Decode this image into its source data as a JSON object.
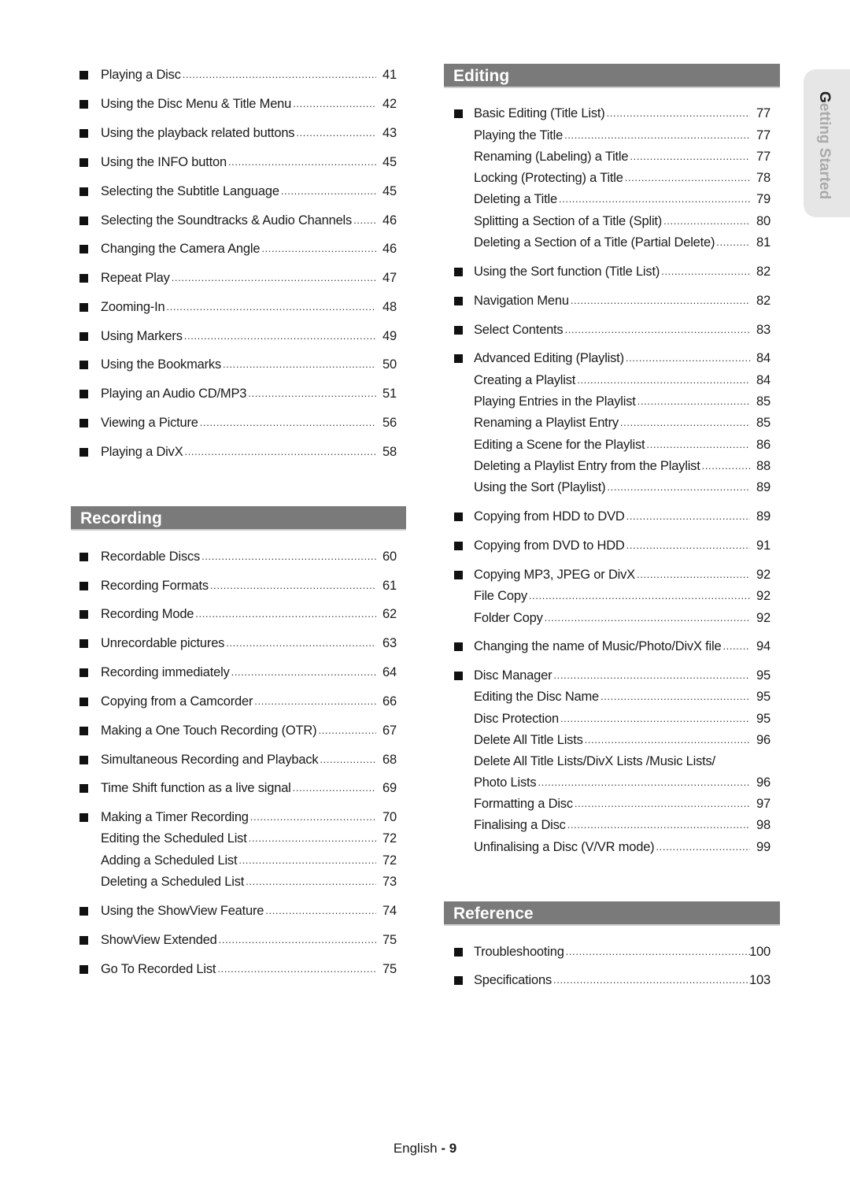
{
  "side_tab": {
    "first_letter": "G",
    "rest": "etting Started"
  },
  "footer": {
    "language": "English",
    "separator": "-",
    "page_number": "9"
  },
  "left": {
    "playback_items": [
      {
        "label": "Playing a Disc",
        "page": "41",
        "bullet": true
      },
      {
        "label": "Using the Disc Menu & Title Menu",
        "page": "42",
        "bullet": true
      },
      {
        "label": "Using the playback related buttons",
        "page": "43",
        "bullet": true
      },
      {
        "label": "Using the INFO button",
        "page": "45",
        "bullet": true
      },
      {
        "label": "Selecting the Subtitle Language",
        "page": "45",
        "bullet": true
      },
      {
        "label": "Selecting the Soundtracks & Audio Channels",
        "page": "46",
        "bullet": true
      },
      {
        "label": "Changing the Camera Angle",
        "page": "46",
        "bullet": true
      },
      {
        "label": "Repeat Play",
        "page": "47",
        "bullet": true
      },
      {
        "label": "Zooming-In",
        "page": "48",
        "bullet": true
      },
      {
        "label": "Using Markers",
        "page": "49",
        "bullet": true
      },
      {
        "label": "Using the Bookmarks",
        "page": "50",
        "bullet": true
      },
      {
        "label": "Playing an Audio CD/MP3",
        "page": "51",
        "bullet": true
      },
      {
        "label": "Viewing a Picture",
        "page": "56",
        "bullet": true
      },
      {
        "label": "Playing a DivX",
        "page": "58",
        "bullet": true
      }
    ],
    "recording": {
      "title": "Recording",
      "items": [
        {
          "label": "Recordable Discs",
          "page": "60",
          "bullet": true
        },
        {
          "label": "Recording Formats",
          "page": "61",
          "bullet": true
        },
        {
          "label": "Recording Mode",
          "page": "62",
          "bullet": true
        },
        {
          "label": "Unrecordable pictures",
          "page": "63",
          "bullet": true
        },
        {
          "label": "Recording immediately",
          "page": "64",
          "bullet": true
        },
        {
          "label": "Copying from a Camcorder",
          "page": "66",
          "bullet": true
        },
        {
          "label": "Making a One Touch Recording (OTR)",
          "page": "67",
          "bullet": true
        },
        {
          "label": "Simultaneous Recording and Playback",
          "page": "68",
          "bullet": true
        },
        {
          "label": "Time Shift function as a live signal",
          "page": "69",
          "bullet": true
        },
        {
          "label": "Making a Timer Recording",
          "page": "70",
          "bullet": true
        },
        {
          "label": "Editing the Scheduled List",
          "page": "72",
          "bullet": false
        },
        {
          "label": "Adding a Scheduled List",
          "page": "72",
          "bullet": false
        },
        {
          "label": "Deleting a Scheduled List",
          "page": "73",
          "bullet": false
        },
        {
          "label": "Using the ShowView Feature",
          "page": "74",
          "bullet": true
        },
        {
          "label": "ShowView Extended",
          "page": "75",
          "bullet": true
        },
        {
          "label": "Go To Recorded List",
          "page": "75",
          "bullet": true
        }
      ]
    }
  },
  "right": {
    "editing": {
      "title": "Editing",
      "items": [
        {
          "label": "Basic Editing (Title List)",
          "page": "77",
          "bullet": true
        },
        {
          "label": "Playing the Title",
          "page": "77",
          "bullet": false
        },
        {
          "label": "Renaming (Labeling) a Title",
          "page": "77",
          "bullet": false
        },
        {
          "label": "Locking (Protecting) a Title",
          "page": "78",
          "bullet": false
        },
        {
          "label": "Deleting a Title",
          "page": "79",
          "bullet": false
        },
        {
          "label": "Splitting a Section of a Title (Split)",
          "page": "80",
          "bullet": false
        },
        {
          "label": "Deleting a Section of a Title (Partial Delete)",
          "page": "81",
          "bullet": false
        },
        {
          "label": "Using the Sort function (Title List)",
          "page": "82",
          "bullet": true
        },
        {
          "label": "Navigation Menu",
          "page": "82",
          "bullet": true
        },
        {
          "label": "Select Contents",
          "page": "83",
          "bullet": true
        },
        {
          "label": "Advanced Editing (Playlist)",
          "page": "84",
          "bullet": true
        },
        {
          "label": "Creating a Playlist",
          "page": "84",
          "bullet": false
        },
        {
          "label": "Playing Entries in the Playlist",
          "page": "85",
          "bullet": false
        },
        {
          "label": "Renaming a Playlist Entry",
          "page": "85",
          "bullet": false
        },
        {
          "label": "Editing a Scene for the Playlist",
          "page": "86",
          "bullet": false
        },
        {
          "label": "Deleting a Playlist Entry from the Playlist",
          "page": "88",
          "bullet": false
        },
        {
          "label": "Using the Sort (Playlist)",
          "page": "89",
          "bullet": false
        },
        {
          "label": "Copying from HDD to DVD",
          "page": "89",
          "bullet": true
        },
        {
          "label": "Copying from DVD to HDD",
          "page": "91",
          "bullet": true
        },
        {
          "label": "Copying MP3, JPEG or DivX",
          "page": "92",
          "bullet": true
        },
        {
          "label": "File Copy",
          "page": "92",
          "bullet": false
        },
        {
          "label": "Folder Copy",
          "page": "92",
          "bullet": false
        },
        {
          "label": "Changing the name of Music/Photo/DivX file",
          "page": "94",
          "bullet": true
        },
        {
          "label": "Disc Manager",
          "page": "95",
          "bullet": true
        },
        {
          "label": "Editing the Disc Name",
          "page": "95",
          "bullet": false
        },
        {
          "label": "Disc Protection",
          "page": "95",
          "bullet": false
        },
        {
          "label": "Delete All Title Lists",
          "page": "96",
          "bullet": false
        },
        {
          "label": "Delete All Title Lists/DivX Lists /Music Lists/",
          "page": "",
          "bullet": false
        },
        {
          "label": "Photo Lists",
          "page": "96",
          "bullet": false
        },
        {
          "label": "Formatting a Disc",
          "page": "97",
          "bullet": false
        },
        {
          "label": "Finalising a Disc",
          "page": "98",
          "bullet": false
        },
        {
          "label": "Unfinalising a Disc (V/VR mode)",
          "page": "99",
          "bullet": false
        }
      ]
    },
    "reference": {
      "title": "Reference",
      "items": [
        {
          "label": "Troubleshooting",
          "page": "100",
          "bullet": true
        },
        {
          "label": "Specifications",
          "page": "103",
          "bullet": true
        }
      ]
    }
  }
}
